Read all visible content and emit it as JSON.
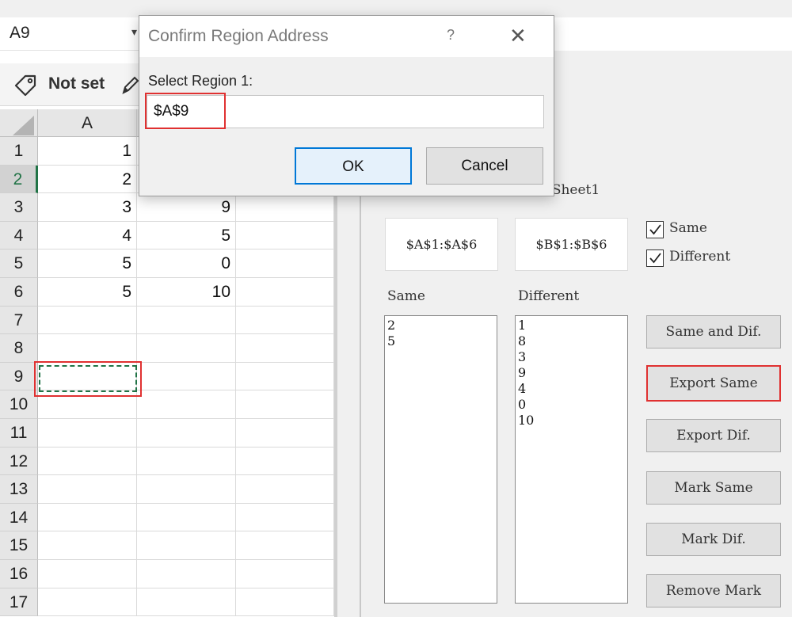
{
  "namebox": {
    "value": "A9"
  },
  "sensitivity": {
    "label": "Not set"
  },
  "grid": {
    "col_header": "A",
    "rows": [
      {
        "n": "1",
        "a": "1",
        "b": ""
      },
      {
        "n": "2",
        "a": "2",
        "b": ""
      },
      {
        "n": "3",
        "a": "3",
        "b": "9"
      },
      {
        "n": "4",
        "a": "4",
        "b": "5"
      },
      {
        "n": "5",
        "a": "5",
        "b": "0"
      },
      {
        "n": "6",
        "a": "5",
        "b": "10"
      },
      {
        "n": "7",
        "a": "",
        "b": ""
      },
      {
        "n": "8",
        "a": "",
        "b": ""
      },
      {
        "n": "9",
        "a": "",
        "b": ""
      },
      {
        "n": "10",
        "a": "",
        "b": ""
      },
      {
        "n": "11",
        "a": "",
        "b": ""
      },
      {
        "n": "12",
        "a": "",
        "b": ""
      },
      {
        "n": "13",
        "a": "",
        "b": ""
      },
      {
        "n": "14",
        "a": "",
        "b": ""
      },
      {
        "n": "15",
        "a": "",
        "b": ""
      },
      {
        "n": "16",
        "a": "",
        "b": ""
      },
      {
        "n": "17",
        "a": "",
        "b": ""
      }
    ]
  },
  "panel": {
    "compare_label": "1Sheet1",
    "range1": "$A$1:$A$6",
    "range2": "$B$1:$B$6",
    "chk_same": {
      "label": "Same",
      "checked": true
    },
    "chk_different": {
      "label": "Different",
      "checked": true
    },
    "same_header": "Same",
    "different_header": "Different",
    "same_items": [
      "2",
      "5"
    ],
    "different_items": [
      "1",
      "8",
      "3",
      "9",
      "4",
      "0",
      "10"
    ],
    "buttons": {
      "same_and_dif": "Same and Dif.",
      "export_same": "Export Same",
      "export_dif": "Export Dif.",
      "mark_same": "Mark Same",
      "mark_dif": "Mark Dif.",
      "remove_mark": "Remove Mark"
    }
  },
  "dialog": {
    "title": "Confirm Region Address",
    "help": "?",
    "close": "✕",
    "prompt": "Select Region 1:",
    "input_value": "$A$9",
    "ok": "OK",
    "cancel": "Cancel"
  },
  "colors": {
    "highlight": "#e03131",
    "excel_green": "#217346",
    "focus_blue": "#0078d7"
  }
}
